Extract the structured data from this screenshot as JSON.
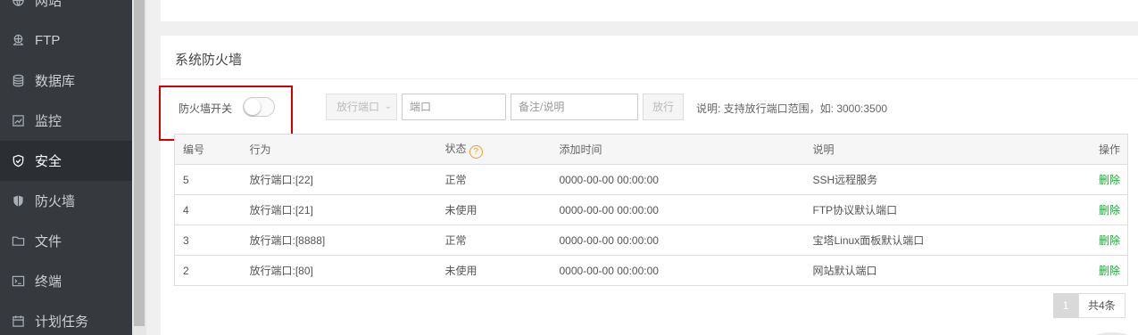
{
  "sidebar": {
    "items": [
      {
        "label": "网站",
        "icon": "globe-icon"
      },
      {
        "label": "FTP",
        "icon": "ftp-icon"
      },
      {
        "label": "数据库",
        "icon": "database-icon"
      },
      {
        "label": "监控",
        "icon": "monitor-icon"
      },
      {
        "label": "安全",
        "icon": "shield-check-icon",
        "active": true
      },
      {
        "label": "防火墙",
        "icon": "shield-icon"
      },
      {
        "label": "文件",
        "icon": "folder-icon"
      },
      {
        "label": "终端",
        "icon": "terminal-icon"
      },
      {
        "label": "计划任务",
        "icon": "calendar-icon"
      }
    ]
  },
  "panel": {
    "title": "系统防火墙",
    "firewall_switch_label": "防火墙开关",
    "firewall_switch_on": false,
    "port_select_value": "放行端口",
    "port_placeholder": "端口",
    "note_placeholder": "备注/说明",
    "allow_button": "放行",
    "hint": "说明: 支持放行端口范围，如: 3000:3500"
  },
  "table": {
    "headers": {
      "id": "编号",
      "action": "行为",
      "status": "状态",
      "added": "添加时间",
      "desc": "说明",
      "op": "操作"
    },
    "help_icon_glyph": "?",
    "rows": [
      {
        "id": "5",
        "action": "放行端口:[22]",
        "status": "正常",
        "added": "0000-00-00 00:00:00",
        "desc": "SSH远程服务",
        "op": "删除"
      },
      {
        "id": "4",
        "action": "放行端口:[21]",
        "status": "未使用",
        "added": "0000-00-00 00:00:00",
        "desc": "FTP协议默认端口",
        "op": "删除"
      },
      {
        "id": "3",
        "action": "放行端口:[8888]",
        "status": "正常",
        "added": "0000-00-00 00:00:00",
        "desc": "宝塔Linux面板默认端口",
        "op": "删除"
      },
      {
        "id": "2",
        "action": "放行端口:[80]",
        "status": "未使用",
        "added": "0000-00-00 00:00:00",
        "desc": "网站默认端口",
        "op": "删除"
      }
    ]
  },
  "pager": {
    "current": "1",
    "total": "共4条"
  },
  "colors": {
    "accent_green": "#20a53a",
    "highlight_red": "#d40000",
    "sidebar_bg": "#363a3f"
  }
}
